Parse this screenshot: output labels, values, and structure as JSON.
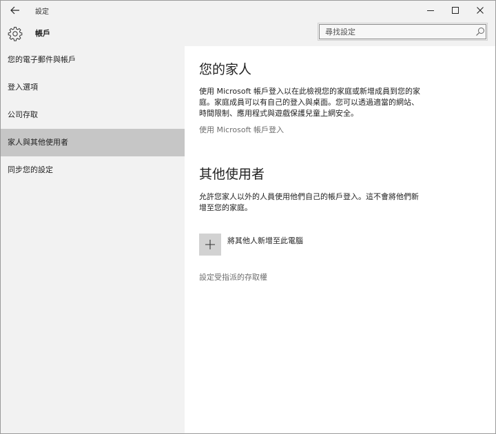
{
  "window": {
    "title": "設定"
  },
  "header": {
    "title": "帳戶",
    "search": {
      "placeholder": "尋找設定",
      "value": ""
    }
  },
  "sidebar": {
    "items": [
      {
        "label": "您的電子郵件與帳戶",
        "selected": false
      },
      {
        "label": "登入選項",
        "selected": false
      },
      {
        "label": "公司存取",
        "selected": false
      },
      {
        "label": "家人與其他使用者",
        "selected": true
      },
      {
        "label": "同步您的設定",
        "selected": false
      }
    ]
  },
  "main": {
    "family": {
      "heading": "您的家人",
      "description_line1": "使用 Microsoft 帳戶登入以在此檢視您的家庭或新增成員到您的家",
      "description_line2": "庭。家庭成員可以有自己的登入與桌面。您可以透過適當的網站、",
      "description_line3": "時間限制、應用程式與遊戲保護兒童上網安全。",
      "link": "使用 Microsoft 帳戶登入"
    },
    "other_users": {
      "heading": "其他使用者",
      "description_line1": "允許您家人以外的人員使用他們自己的帳戶登入。這不會將他們新",
      "description_line2": "增至您的家庭。",
      "add_label": "將其他人新增至此電腦",
      "assigned_access_link": "設定受指派的存取權"
    }
  },
  "colors": {
    "chrome_bg": "#f2f2f2",
    "selected_bg": "#c6c6c6",
    "content_bg": "#ffffff",
    "link_gray": "#6e6e6e",
    "tile_gray": "#d2d2d2"
  },
  "icons": {
    "back": "back-arrow-icon",
    "minimize": "minimize-icon",
    "maximize": "maximize-icon",
    "close": "close-icon",
    "settings": "gear-icon",
    "search": "search-icon",
    "add": "plus-icon"
  }
}
